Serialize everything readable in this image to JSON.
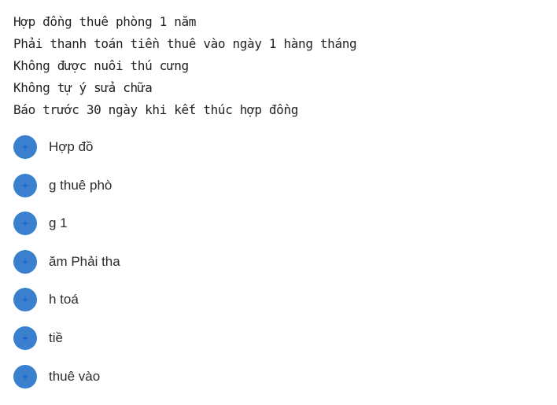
{
  "terms": [
    "Hợp đồng thuê phòng 1 năm",
    "Phải thanh toán tiền thuê vào ngày 1 hàng tháng",
    "Không được nuôi thú cưng",
    "Không tự ý sửa chữa",
    "Báo trước 30 ngày khi kết thúc hợp đồng"
  ],
  "chips": [
    {
      "label": "Hợp đồ",
      "icon": "plus-icon"
    },
    {
      "label": "g thuê phò",
      "icon": "plus-icon"
    },
    {
      "label": "g 1",
      "icon": "plus-icon"
    },
    {
      "label": "ăm Phải tha",
      "icon": "plus-icon"
    },
    {
      "label": "h toá",
      "icon": "plus-icon"
    },
    {
      "label": "tiề",
      "icon": "plus-icon"
    },
    {
      "label": "thuê vào",
      "icon": "plus-icon"
    }
  ],
  "colors": {
    "chip_circle": "#3b7fcf",
    "plus_glyph": "#1a5fd0",
    "text": "#222222"
  }
}
